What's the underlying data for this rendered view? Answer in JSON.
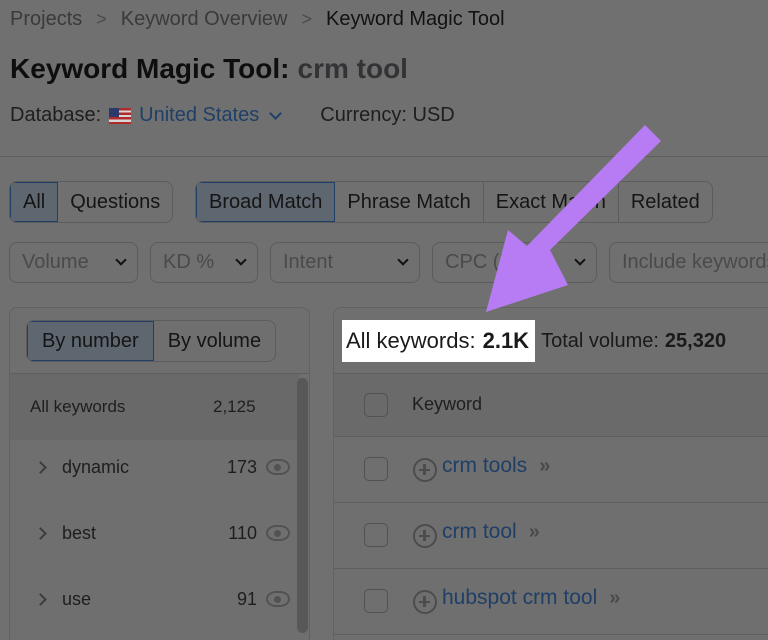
{
  "breadcrumb": [
    {
      "label": "Projects"
    },
    {
      "label": "Keyword Overview"
    },
    {
      "label": "Keyword Magic Tool"
    }
  ],
  "breadcrumb_separator": ">",
  "page": {
    "title": "Keyword Magic Tool:",
    "query": "crm tool"
  },
  "meta": {
    "database_label": "Database:",
    "database_flag_icon": "us-flag-icon",
    "database_value": "United States",
    "currency_label": "Currency: USD"
  },
  "question_tabs": [
    {
      "label": "All",
      "active": true
    },
    {
      "label": "Questions",
      "active": false
    }
  ],
  "match_tabs": [
    {
      "label": "Broad Match",
      "active": true
    },
    {
      "label": "Phrase Match",
      "active": false
    },
    {
      "label": "Exact Match",
      "active": false
    },
    {
      "label": "Related",
      "active": false
    }
  ],
  "filters": [
    {
      "label": "Volume"
    },
    {
      "label": "KD %"
    },
    {
      "label": "Intent"
    },
    {
      "label": "CPC (USD)"
    },
    {
      "label": "Include keywords"
    }
  ],
  "groups_panel": {
    "toggle": [
      {
        "label": "By number",
        "active": true
      },
      {
        "label": "By volume",
        "active": false
      }
    ],
    "all_row": {
      "label": "All keywords",
      "count": "2,125"
    },
    "groups": [
      {
        "name": "dynamic",
        "count": "173"
      },
      {
        "name": "best",
        "count": "110"
      },
      {
        "name": "use",
        "count": "91"
      }
    ]
  },
  "results": {
    "all_keywords_label": "All keywords:",
    "all_keywords_value": "2.1K",
    "total_volume_label": "Total volume:",
    "total_volume_value": "25,320",
    "column_keyword": "Keyword",
    "rows": [
      {
        "keyword": "crm tools",
        "more": "»"
      },
      {
        "keyword": "crm tool",
        "more": "»"
      },
      {
        "keyword": "hubspot crm tool",
        "more": "»"
      }
    ]
  },
  "annotation": {
    "arrow_color": "#b77cf4",
    "highlight_color": "#ffffff"
  }
}
